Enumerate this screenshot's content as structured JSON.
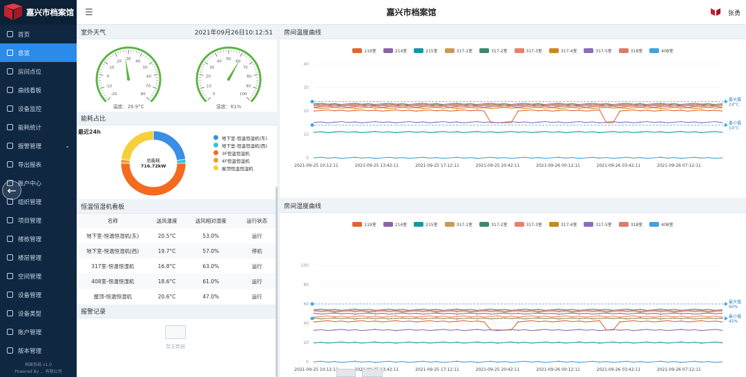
{
  "app": {
    "title": "嘉兴市档案馆",
    "user": "张勇"
  },
  "sidebar": {
    "items": [
      {
        "label": "首页"
      },
      {
        "label": "总览"
      },
      {
        "label": "房间点位"
      },
      {
        "label": "曲线看板"
      },
      {
        "label": "设备监控"
      },
      {
        "label": "能耗统计"
      },
      {
        "label": "报警管理"
      },
      {
        "label": "导出报表"
      },
      {
        "label": "账户中心"
      },
      {
        "label": "组织管理"
      },
      {
        "label": "项目管理"
      },
      {
        "label": "楼栋管理"
      },
      {
        "label": "楼层管理"
      },
      {
        "label": "空间管理"
      },
      {
        "label": "设备管理"
      },
      {
        "label": "设备类型"
      },
      {
        "label": "账户管理"
      },
      {
        "label": "版本管理"
      }
    ],
    "active_index": 1,
    "footer_line1": "档案系统 v1.0",
    "footer_line2": "Powered By ... 有限公司"
  },
  "weather": {
    "title": "室外天气",
    "datetime": "2021年09月26日10:12:51",
    "temp_caption": "温度：26.9°C",
    "temp_value": 26.9,
    "temp_ticks": [
      "-20",
      "-10",
      "0",
      "10",
      "20",
      "30",
      "40",
      "50",
      "60",
      "70",
      "80"
    ],
    "humidity_caption": "湿度：61%",
    "humidity_value": 61,
    "humidity_ticks": [
      "0",
      "10",
      "20",
      "30",
      "40",
      "50",
      "60",
      "70",
      "80",
      "90",
      "100"
    ]
  },
  "energy": {
    "title": "能耗占比",
    "period": "最近24h",
    "total_label": "总能耗",
    "total_value": "716.72kW",
    "legend": [
      {
        "label": "地下室-恒温恒湿机(东)",
        "color": "#3a8ee6",
        "share": 0.23
      },
      {
        "label": "地下室-恒温恒湿机(西)",
        "color": "#2ec4e0",
        "share": 0.02
      },
      {
        "label": "3F恒温恒湿机",
        "color": "#f46a1f",
        "share": 0.5
      },
      {
        "label": "4F恒温恒湿机",
        "color": "#f0a030",
        "share": 0.02
      },
      {
        "label": "屋顶恒温恒湿机",
        "color": "#f6d039",
        "share": 0.23
      }
    ]
  },
  "board": {
    "title": "恒温恒湿机看板",
    "columns": [
      "名称",
      "送风温度",
      "送风相对湿度",
      "运行状态"
    ],
    "rows": [
      [
        "地下室-恒温恒湿机(东)",
        "20.5°C",
        "53.0%",
        "运行"
      ],
      [
        "地下室-恒温恒湿机(西)",
        "19.7°C",
        "57.0%",
        "停机"
      ],
      [
        "317室-恒温恒湿机",
        "16.8°C",
        "63.0%",
        "运行"
      ],
      [
        "408室-恒温恒湿机",
        "18.6°C",
        "61.0%",
        "运行"
      ],
      [
        "屋顶-恒温恒湿机",
        "20.6°C",
        "47.0%",
        "运行"
      ]
    ]
  },
  "alarms": {
    "title": "报警记录",
    "empty": "暂无数据"
  },
  "colors": {
    "series": [
      "#e8622c",
      "#8d63a8",
      "#129aa3",
      "#c79a55",
      "#3c8a6b",
      "#e8806a",
      "#c98a16",
      "#8a6cc0",
      "#d97c70",
      "#3fa3dc"
    ]
  },
  "chart_data": [
    {
      "type": "line",
      "title": "房间温度曲线",
      "legend": [
        "119室",
        "214室",
        "215室",
        "317-1室",
        "317-2室",
        "317-3室",
        "317-4室",
        "317-5室",
        "318室",
        "408室"
      ],
      "x_ticks": [
        "2021-09-25 10:12:11",
        "2021-09-25 13:42:11",
        "2021-09-25 17:12:11",
        "2021-09-25 20:42:11",
        "2021-09-26 00:12:11",
        "2021-09-26 03:42:11",
        "2021-09-26 07:12:11"
      ],
      "y_ticks": [
        "0",
        "10",
        "20",
        "30",
        "40"
      ],
      "ylim": [
        0,
        40
      ],
      "series": [
        {
          "name": "119室",
          "value": 20.2,
          "dips": [
            [
              0.43,
              0.5,
              15
            ],
            [
              0.7,
              0.75,
              15
            ]
          ]
        },
        {
          "name": "214室",
          "value": 22.2
        },
        {
          "name": "215室",
          "value": 11
        },
        {
          "name": "317-1室",
          "value": 22.8
        },
        {
          "name": "317-2室",
          "value": 23.0
        },
        {
          "name": "317-3室",
          "value": 21.8
        },
        {
          "name": "317-4室",
          "value": 21.3
        },
        {
          "name": "317-5室",
          "value": 15.2
        },
        {
          "name": "318室",
          "value": 22.6
        },
        {
          "name": "408室",
          "value": 0
        }
      ],
      "markers": [
        {
          "label": "最大值",
          "value_text": "24°C",
          "value": 24
        },
        {
          "label": "最小值",
          "value_text": "14°C",
          "value": 14
        }
      ]
    },
    {
      "type": "line",
      "title": "房间湿度曲线",
      "legend": [
        "119室",
        "214室",
        "215室",
        "317-1室",
        "317-2室",
        "317-3室",
        "317-4室",
        "317-5室",
        "318室",
        "408室"
      ],
      "x_ticks": [
        "2021-09-25 10:12:11",
        "2021-09-25 13:42:11",
        "2021-09-25 17:12:11",
        "2021-09-25 20:42:11",
        "2021-09-26 00:12:11",
        "2021-09-26 03:42:11",
        "2021-09-26 07:12:11"
      ],
      "y_ticks": [
        "0",
        "20",
        "40",
        "60",
        "80",
        "100"
      ],
      "ylim": [
        0,
        100
      ],
      "series": [
        {
          "name": "119室",
          "value": 42,
          "dips": [
            [
              0.43,
              0.5,
              33
            ],
            [
              0.7,
              0.75,
              33
            ]
          ]
        },
        {
          "name": "214室",
          "value": 50
        },
        {
          "name": "215室",
          "value": 20
        },
        {
          "name": "317-1室",
          "value": 52
        },
        {
          "name": "317-2室",
          "value": 54
        },
        {
          "name": "317-3室",
          "value": 47
        },
        {
          "name": "317-4室",
          "value": 45
        },
        {
          "name": "317-5室",
          "value": 33
        },
        {
          "name": "318室",
          "value": 53
        },
        {
          "name": "408室",
          "value": 0
        }
      ],
      "markers": [
        {
          "label": "最大值",
          "value_text": "60%",
          "value": 60
        },
        {
          "label": "最小值",
          "value_text": "45%",
          "value": 45
        }
      ]
    }
  ]
}
